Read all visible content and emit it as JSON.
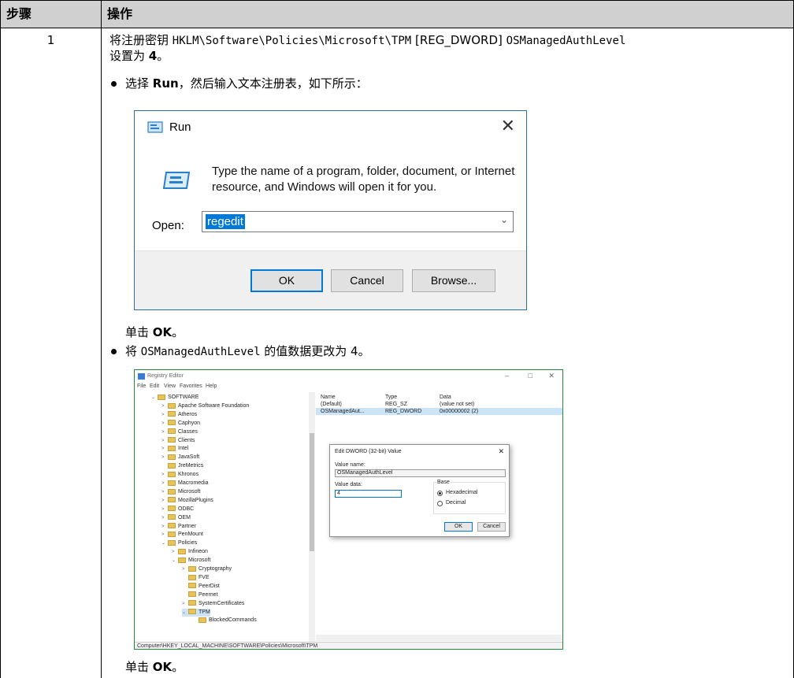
{
  "table": {
    "header_step": "步骤",
    "header_operation": "操作",
    "step_number": "1"
  },
  "step": {
    "line1_prefix": "将注册密钥 ",
    "registry_path": "HKLM\\Software\\Policies\\Microsoft\\TPM",
    "reg_type": " [REG_DWORD] ",
    "value_name": "OSManagedAuthLevel",
    "line2_prefix": "设置为 ",
    "line2_value": "4",
    "line2_suffix": "。",
    "bullet1_prefix": "选择 ",
    "bullet1_bold": "Run",
    "bullet1_suffix": "，然后输入文本注册表，如下所示：",
    "click1_prefix": "单击 ",
    "click1_bold": "OK",
    "click1_suffix": "。",
    "bullet2_prefix": "将 ",
    "bullet2_value_name": "OSManagedAuthLevel",
    "bullet2_suffix": " 的值数据更改为 4。",
    "click2_prefix": "单击 ",
    "click2_bold": "OK",
    "click2_suffix": "。"
  },
  "run_dialog": {
    "title": "Run",
    "close_glyph": "✕",
    "description_line1": "Type the name of a program, folder, document, or Internet",
    "description_line2": "resource, and Windows will open it for you.",
    "open_label": "Open:",
    "open_value": "regedit",
    "ok_label": "OK",
    "cancel_label": "Cancel",
    "browse_label": "Browse..."
  },
  "registry_editor": {
    "title": "Registry Editor",
    "menu": [
      "File",
      "Edit",
      "View",
      "Favorites",
      "Help"
    ],
    "tree": [
      {
        "label": "SOFTWARE",
        "indent": 1,
        "expander": "⌄"
      },
      {
        "label": "Apache Software Foundation",
        "indent": 2,
        "expander": ">"
      },
      {
        "label": "Atheros",
        "indent": 2,
        "expander": ">"
      },
      {
        "label": "Caphyon",
        "indent": 2,
        "expander": ">"
      },
      {
        "label": "Classes",
        "indent": 2,
        "expander": ">"
      },
      {
        "label": "Clients",
        "indent": 2,
        "expander": ">"
      },
      {
        "label": "Intel",
        "indent": 2,
        "expander": ">"
      },
      {
        "label": "JavaSoft",
        "indent": 2,
        "expander": ">"
      },
      {
        "label": "JreMetrics",
        "indent": 2,
        "expander": ""
      },
      {
        "label": "Khronos",
        "indent": 2,
        "expander": ">"
      },
      {
        "label": "Macromedia",
        "indent": 2,
        "expander": ">"
      },
      {
        "label": "Microsoft",
        "indent": 2,
        "expander": ">"
      },
      {
        "label": "MozillaPlugins",
        "indent": 2,
        "expander": ">"
      },
      {
        "label": "ODBC",
        "indent": 2,
        "expander": ">"
      },
      {
        "label": "OEM",
        "indent": 2,
        "expander": ">"
      },
      {
        "label": "Partner",
        "indent": 2,
        "expander": ">"
      },
      {
        "label": "PenMount",
        "indent": 2,
        "expander": ">"
      },
      {
        "label": "Policies",
        "indent": 2,
        "expander": "⌄"
      },
      {
        "label": "Infineon",
        "indent": 3,
        "expander": ">"
      },
      {
        "label": "Microsoft",
        "indent": 3,
        "expander": "⌄"
      },
      {
        "label": "Cryptography",
        "indent": 4,
        "expander": ">"
      },
      {
        "label": "FVE",
        "indent": 4,
        "expander": ""
      },
      {
        "label": "PeerDist",
        "indent": 4,
        "expander": ""
      },
      {
        "label": "Peernet",
        "indent": 4,
        "expander": ""
      },
      {
        "label": "SystemCertificates",
        "indent": 4,
        "expander": ">"
      },
      {
        "label": "TPM",
        "indent": 4,
        "expander": "⌄",
        "selected": true
      },
      {
        "label": "BlockedCommands",
        "indent": 5,
        "expander": ""
      }
    ],
    "columns": {
      "name": "Name",
      "type": "Type",
      "data": "Data"
    },
    "values": [
      {
        "name": "(Default)",
        "type": "REG_SZ",
        "data": "(value not set)"
      },
      {
        "name": "OSManagedAut...",
        "type": "REG_DWORD",
        "data": "0x00000002 (2)"
      }
    ],
    "status_path": "Computer\\HKEY_LOCAL_MACHINE\\SOFTWARE\\Policies\\Microsoft\\TPM",
    "edit_dialog": {
      "title": "Edit DWORD (32-bit) Value",
      "value_name_label": "Value name:",
      "value_name": "OSManagedAuthLevel",
      "value_data_label": "Value data:",
      "value_data": "4",
      "base_label": "Base",
      "hex_label": "Hexadecimal",
      "dec_label": "Decimal",
      "ok_label": "OK",
      "cancel_label": "Cancel"
    }
  }
}
